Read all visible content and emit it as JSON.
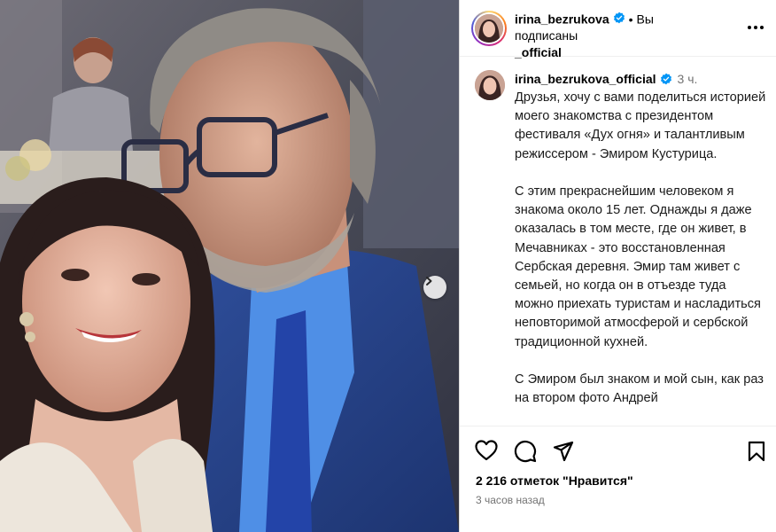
{
  "post": {
    "username_line1": "irina_bezrukova",
    "username_line2": "_official",
    "follow_state": "Вы подписаны",
    "more": "•••"
  },
  "caption": {
    "username": "irina_bezrukova_official",
    "time": "3 ч.",
    "text": "Друзья, хочу с вами поделиться историей моего знакомства с президентом фестиваля «Дух огня» и талантливым режиссером - Эмиром Кустурица.\n\nС этим прекраснейшим человеком я знакома около 15 лет. Однажды я даже оказалась в том месте, где он живет, в Мечавниках - это восстановленная Сербская деревня. Эмир там живет с семьей, но когда он в отъезде туда можно приехать туристам и насладиться неповторимой атмосферой и сербской традиционной кухней.\n\nС Эмиром был знаком и мой сын, как раз на втором фото Андрей"
  },
  "stats": {
    "likes": "2 216 отметок \"Нравится\"",
    "time_ago": "3 часов назад"
  },
  "icons": {
    "like": "heart-icon",
    "comment": "comment-icon",
    "share": "share-icon",
    "save": "bookmark-icon",
    "verified": "verified-badge-icon",
    "next": "chevron-right-icon"
  },
  "colors": {
    "verified": "#0095f6",
    "secondary_text": "#737373"
  }
}
